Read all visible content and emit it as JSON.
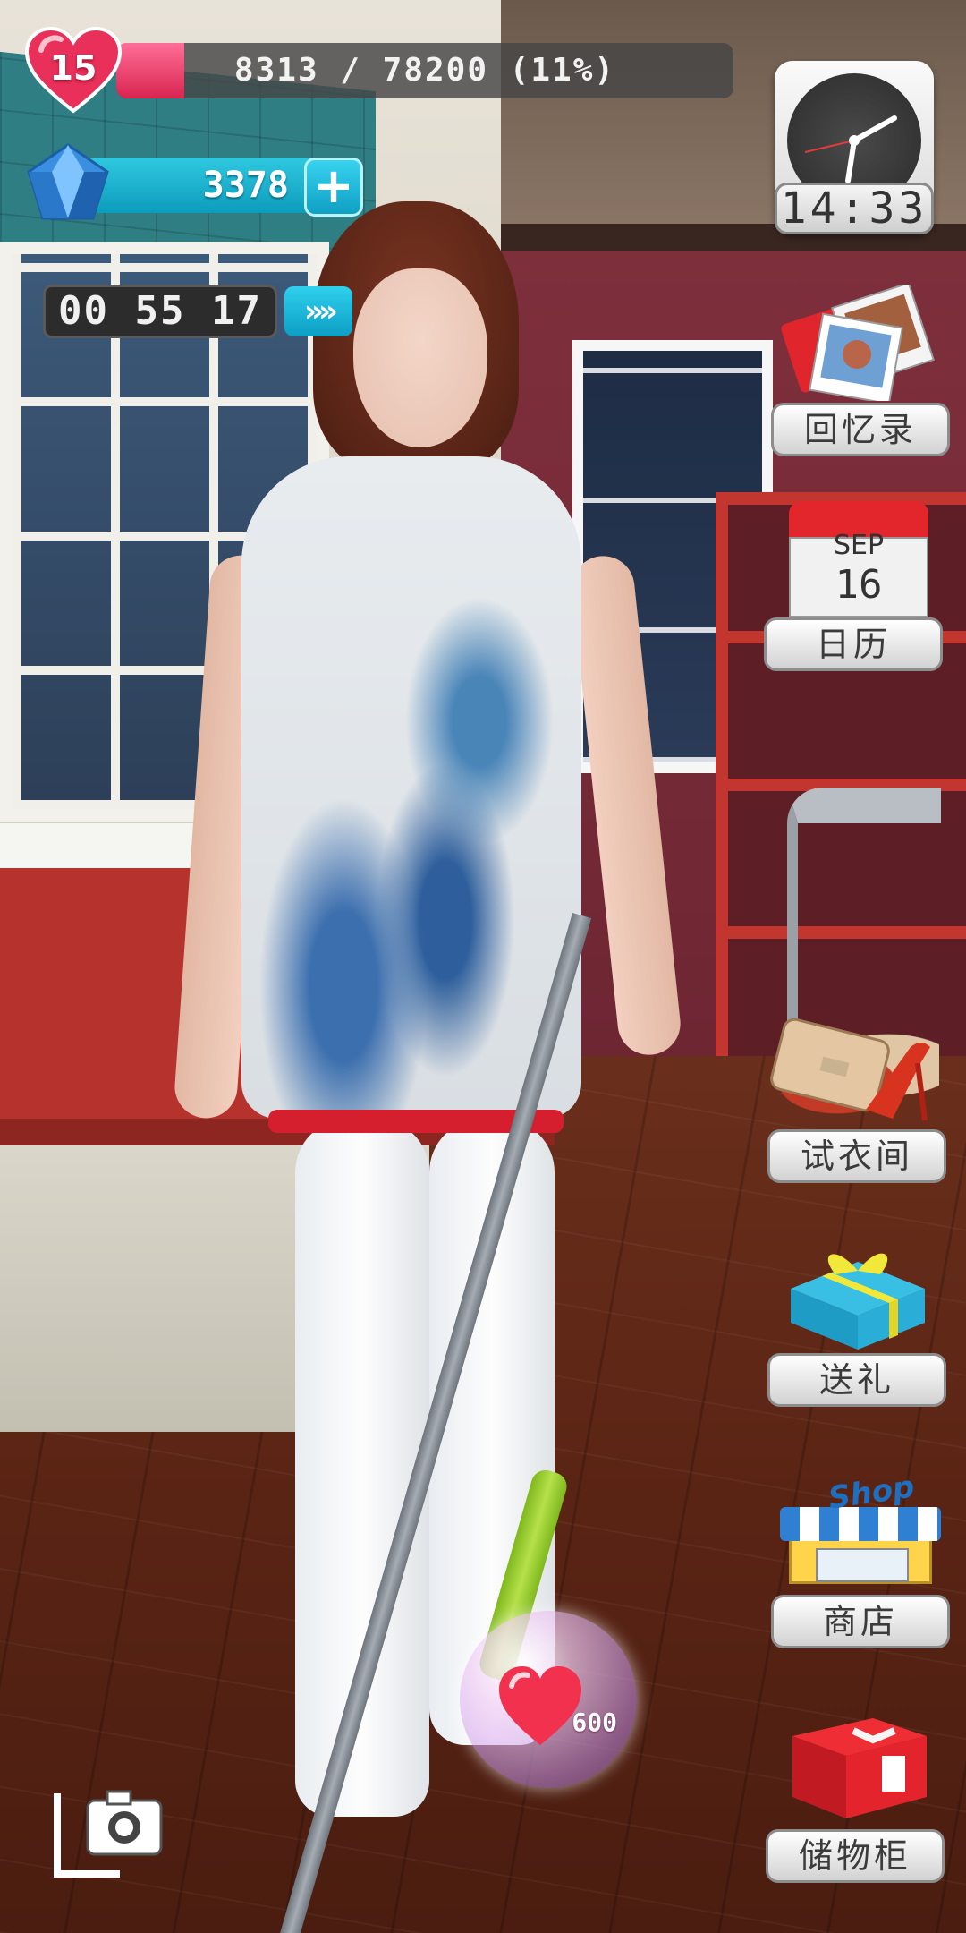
{
  "hud": {
    "level": "15",
    "exp_text": "8313 / 78200 (11%)",
    "exp_progress": 0.11,
    "gems": "3378",
    "plus_label": "+",
    "timer": "00 55 17",
    "skip_label": "»»"
  },
  "clock": {
    "time": "14:33"
  },
  "menu": {
    "memories_label": "回忆录",
    "calendar_month": "SEP",
    "calendar_day": "16",
    "calendar_label": "日历",
    "dressing_label": "试衣间",
    "gift_label": "送礼",
    "shop_sign": "Shop",
    "shop_label": "商店",
    "locker_label": "储物柜"
  },
  "heart_bubble": {
    "value": "600"
  },
  "icons": {
    "level": "heart-level-icon",
    "gems": "diamond-icon",
    "clock": "clock-icon",
    "memories": "photos-icon",
    "calendar": "calendar-icon",
    "dressing": "handbag-heels-icon",
    "gift": "gift-box-icon",
    "shop": "shop-storefront-icon",
    "locker": "red-box-icon",
    "camera": "camera-icon"
  },
  "colors": {
    "exp_fill": "#d8254f",
    "gem_bar": "#0d9cbc",
    "label_bg": "#d2d2d2"
  }
}
